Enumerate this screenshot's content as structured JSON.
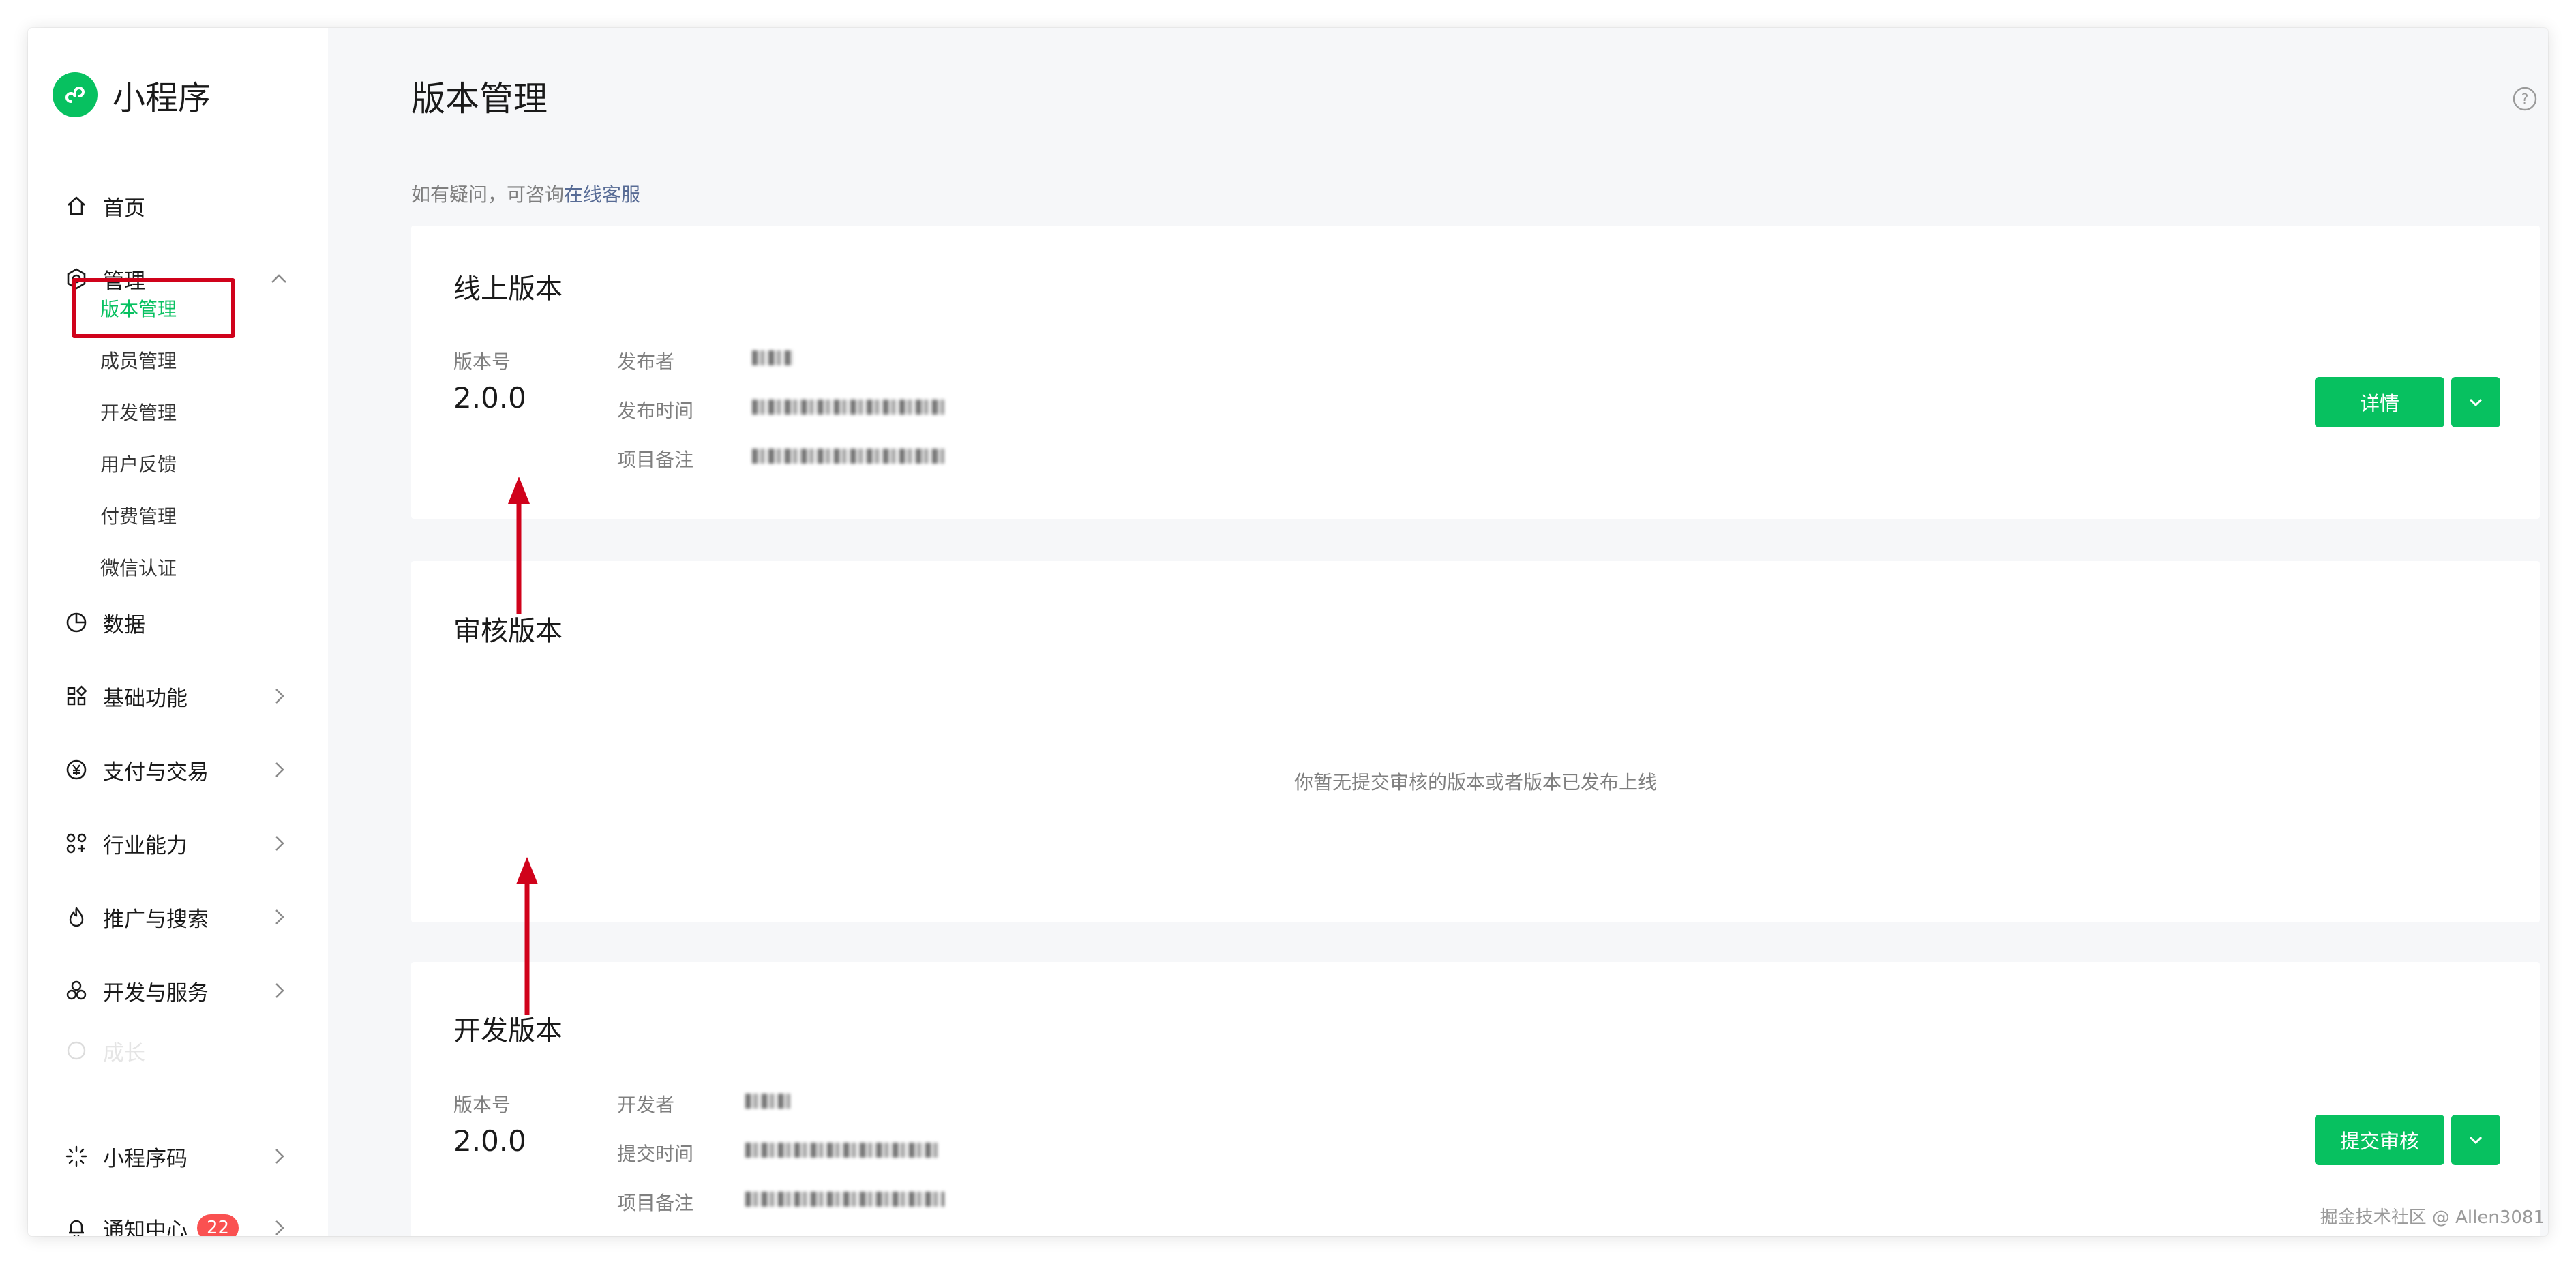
{
  "app": {
    "name": "小程序",
    "accent": "#07c160"
  },
  "sidebar": {
    "home": "首页",
    "manage": "管理",
    "manage_sub": [
      "版本管理",
      "成员管理",
      "开发管理",
      "用户反馈",
      "付费管理",
      "微信认证"
    ],
    "data": "数据",
    "basic": "基础功能",
    "pay": "支付与交易",
    "industry": "行业能力",
    "promote": "推广与搜索",
    "devserv": "开发与服务",
    "growth": "成长",
    "qrcode": "小程序码",
    "notice": "通知中心",
    "notice_count": "22"
  },
  "main": {
    "title": "版本管理",
    "hint_prefix": "如有疑问，可咨询",
    "hint_link": "在线客服",
    "online": {
      "title": "线上版本",
      "version_label": "版本号",
      "version": "2.0.0",
      "publisher_label": "发布者",
      "time_label": "发布时间",
      "note_label": "项目备注",
      "detail_button": "详情"
    },
    "review": {
      "title": "审核版本",
      "empty": "你暂无提交审核的版本或者版本已发布上线"
    },
    "dev": {
      "title": "开发版本",
      "version_label": "版本号",
      "version": "2.0.0",
      "developer_label": "开发者",
      "time_label": "提交时间",
      "note_label": "项目备注",
      "submit_button": "提交审核"
    }
  },
  "watermark": "掘金技术社区 @ Allen3081",
  "annotation_color": "#d0021b"
}
